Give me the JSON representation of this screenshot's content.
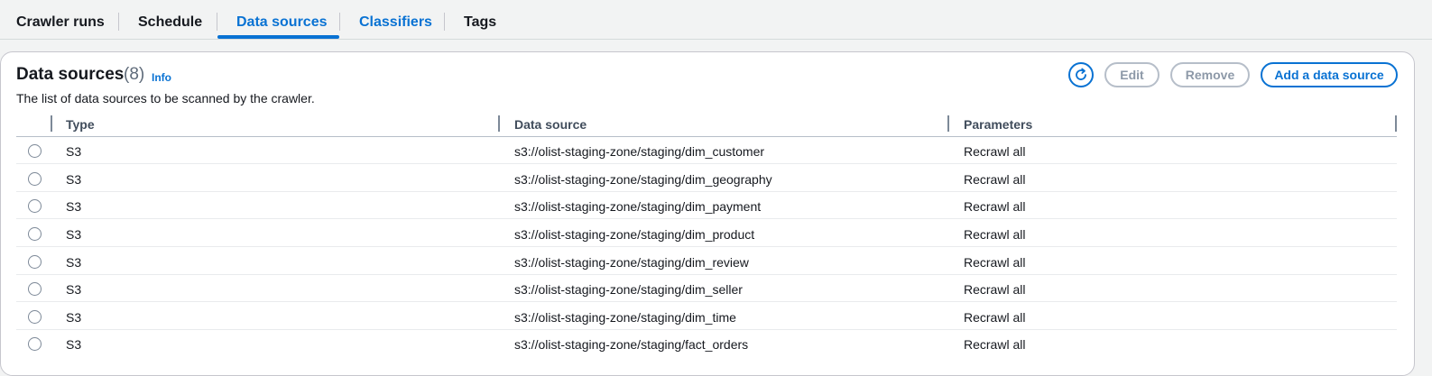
{
  "tabs": [
    {
      "label": "Crawler runs"
    },
    {
      "label": "Schedule"
    },
    {
      "label": "Data sources"
    },
    {
      "label": "Classifiers"
    },
    {
      "label": "Tags"
    }
  ],
  "panel": {
    "title": "Data sources",
    "count": "(8)",
    "info_link": "Info",
    "description": "The list of data sources to be scanned by the crawler.",
    "refresh_icon": "refresh-icon",
    "buttons": {
      "edit": "Edit",
      "remove": "Remove",
      "add": "Add a data source"
    }
  },
  "table": {
    "columns": [
      "Type",
      "Data source",
      "Parameters"
    ],
    "rows": [
      {
        "type": "S3",
        "source": "s3://olist-staging-zone/staging/dim_customer",
        "params": "Recrawl all"
      },
      {
        "type": "S3",
        "source": "s3://olist-staging-zone/staging/dim_geography",
        "params": "Recrawl all"
      },
      {
        "type": "S3",
        "source": "s3://olist-staging-zone/staging/dim_payment",
        "params": "Recrawl all"
      },
      {
        "type": "S3",
        "source": "s3://olist-staging-zone/staging/dim_product",
        "params": "Recrawl all"
      },
      {
        "type": "S3",
        "source": "s3://olist-staging-zone/staging/dim_review",
        "params": "Recrawl all"
      },
      {
        "type": "S3",
        "source": "s3://olist-staging-zone/staging/dim_seller",
        "params": "Recrawl all"
      },
      {
        "type": "S3",
        "source": "s3://olist-staging-zone/staging/dim_time",
        "params": "Recrawl all"
      },
      {
        "type": "S3",
        "source": "s3://olist-staging-zone/staging/fact_orders",
        "params": "Recrawl all"
      }
    ]
  },
  "colors": {
    "accent": "#0972d3",
    "text": "#16191f",
    "disabled": "#8d99a8"
  }
}
